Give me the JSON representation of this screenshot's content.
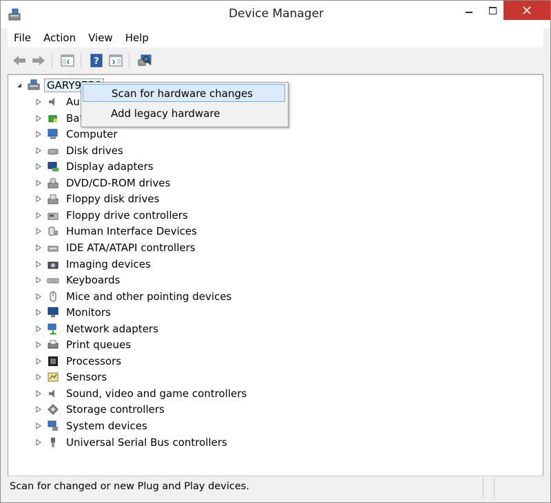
{
  "window": {
    "title": "Device Manager"
  },
  "menu": [
    "File",
    "Action",
    "View",
    "Help"
  ],
  "toolbar": {
    "buttons": [
      "back-icon",
      "forward-icon",
      "console-tree-icon",
      "help-icon",
      "action-pane-icon",
      "scan-hardware-icon"
    ]
  },
  "tree": {
    "root": "GARY9756",
    "categories": [
      {
        "label": "Au",
        "icon": "audio-icon"
      },
      {
        "label": "Bat",
        "icon": "battery-icon"
      },
      {
        "label": "Computer",
        "icon": "computer-icon"
      },
      {
        "label": "Disk drives",
        "icon": "disk-drive-icon"
      },
      {
        "label": "Display adapters",
        "icon": "display-adapter-icon"
      },
      {
        "label": "DVD/CD-ROM drives",
        "icon": "dvd-drive-icon"
      },
      {
        "label": "Floppy disk drives",
        "icon": "floppy-drive-icon"
      },
      {
        "label": "Floppy drive controllers",
        "icon": "floppy-controller-icon"
      },
      {
        "label": "Human Interface Devices",
        "icon": "hid-icon"
      },
      {
        "label": "IDE ATA/ATAPI controllers",
        "icon": "ide-controller-icon"
      },
      {
        "label": "Imaging devices",
        "icon": "imaging-device-icon"
      },
      {
        "label": "Keyboards",
        "icon": "keyboard-icon"
      },
      {
        "label": "Mice and other pointing devices",
        "icon": "mouse-icon"
      },
      {
        "label": "Monitors",
        "icon": "monitor-icon"
      },
      {
        "label": "Network adapters",
        "icon": "network-adapter-icon"
      },
      {
        "label": "Print queues",
        "icon": "printer-icon"
      },
      {
        "label": "Processors",
        "icon": "processor-icon"
      },
      {
        "label": "Sensors",
        "icon": "sensor-icon"
      },
      {
        "label": "Sound, video and game controllers",
        "icon": "sound-icon"
      },
      {
        "label": "Storage controllers",
        "icon": "storage-controller-icon"
      },
      {
        "label": "System devices",
        "icon": "system-device-icon"
      },
      {
        "label": "Universal Serial Bus controllers",
        "icon": "usb-icon"
      }
    ]
  },
  "context_menu": {
    "items": [
      "Scan for hardware changes",
      "Add legacy hardware"
    ],
    "highlighted": "Scan for hardware changes"
  },
  "status": {
    "text": "Scan for changed or new Plug and Play devices."
  },
  "colors": {
    "close": "#c7372f",
    "highlight": "#dbeaf9",
    "highlight_border": "#74a9e4"
  }
}
